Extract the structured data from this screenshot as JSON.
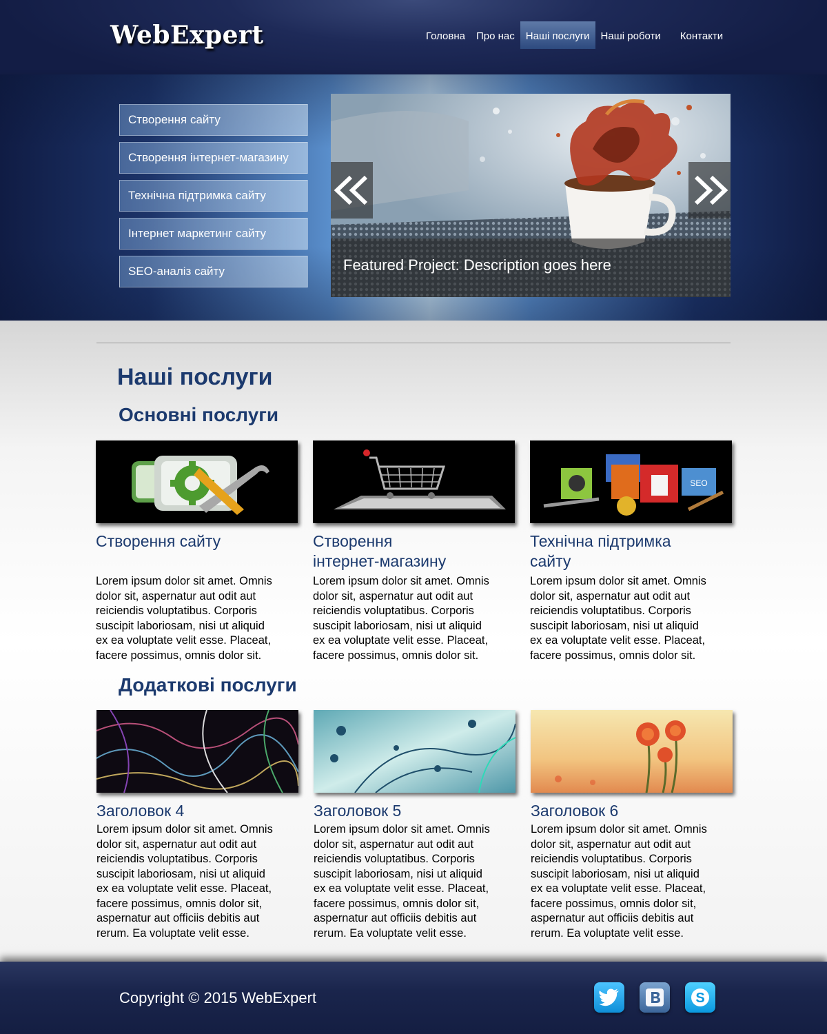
{
  "header": {
    "logo": "WebExpert",
    "nav": [
      {
        "label": "Головна"
      },
      {
        "label": "Про нас"
      },
      {
        "label": "Наші послуги"
      },
      {
        "label": "Наші роботи"
      },
      {
        "label": "Контакти"
      }
    ],
    "active_nav": "Наші послуги"
  },
  "hero": {
    "menu": [
      {
        "label": "Створення сайту"
      },
      {
        "label": "Створення інтернет-магазину"
      },
      {
        "label": "Технічна підтримка сайту"
      },
      {
        "label": "Інтернет маркетинг сайту"
      },
      {
        "label": "SEO-аналіз сайту"
      }
    ],
    "slider": {
      "caption": "Featured Project: Description goes here",
      "prev_icon": "double-chevron-left-icon",
      "next_icon": "double-chevron-right-icon"
    }
  },
  "main": {
    "page_title": "Наші послуги",
    "basic_title": "Основні послуги",
    "basic": [
      {
        "title": "Створення сайту",
        "text": "Lorem ipsum dolor sit amet. Omnis\ndolor sit, aspernatur aut odit aut\nreiciendis voluptatibus. Corporis\nsuscipit laboriosam, nisi ut aliquid\nex ea voluptate velit esse. Placeat,\n facere possimus, omnis dolor sit.",
        "image": "gear-wrench-icon"
      },
      {
        "title": "Створення\nінтернет-магазину",
        "text": "Lorem ipsum dolor sit amet. Omnis\ndolor sit, aspernatur aut odit aut\nreiciendis voluptatibus. Corporis\nsuscipit laboriosam, nisi ut aliquid\nex ea voluptate velit esse. Placeat,\n facere possimus, omnis dolor sit.",
        "image": "shopping-cart-tablet-icon"
      },
      {
        "title": "Технічна підтримка\nсайту",
        "text": "Lorem ipsum dolor sit amet. Omnis\ndolor sit, aspernatur aut odit aut\nreiciendis voluptatibus. Corporis\nsuscipit laboriosam, nisi ut aliquid\nex ea voluptate velit esse. Placeat,\n facere possimus, omnis dolor sit.",
        "image": "tools-boxes-icon"
      }
    ],
    "extra_title": "Додаткові послуги",
    "extra": [
      {
        "title": "Заголовок 4",
        "text": "Lorem ipsum dolor sit amet. Omnis\ndolor sit, aspernatur aut odit aut\nreiciendis voluptatibus. Corporis\nsuscipit laboriosam, nisi ut aliquid\nex ea voluptate velit esse. Placeat,\n facere possimus, omnis dolor sit,\naspernatur aut officiis debitis aut\nrerum. Ea voluptate velit esse."
      },
      {
        "title": "Заголовок 5",
        "text": "Lorem ipsum dolor sit amet. Omnis\ndolor sit, aspernatur aut odit aut\nreiciendis voluptatibus. Corporis\nsuscipit laboriosam, nisi ut aliquid\nex ea voluptate velit esse. Placeat,\n facere possimus, omnis dolor sit,\naspernatur aut officiis debitis aut\nrerum. Ea voluptate velit esse."
      },
      {
        "title": "Заголовок 6",
        "text": "Lorem ipsum dolor sit amet. Omnis\ndolor sit, aspernatur aut odit aut\nreiciendis voluptatibus. Corporis\nsuscipit laboriosam, nisi ut aliquid\nex ea voluptate velit esse. Placeat,\n facere possimus, omnis dolor sit,\naspernatur aut officiis debitis aut\nrerum. Ea voluptate velit esse."
      }
    ]
  },
  "footer": {
    "copyright": "Copyright © 2015 WebExpert",
    "social": [
      {
        "icon": "twitter-icon",
        "color": "#1da1f2"
      },
      {
        "icon": "vk-icon",
        "color": "#4c75a3"
      },
      {
        "icon": "skype-icon",
        "color": "#00aff0"
      }
    ]
  },
  "colors": {
    "header_bg": "#1e2a58",
    "heading": "#1c3a6e",
    "nav_active": "#3d5a8f"
  }
}
